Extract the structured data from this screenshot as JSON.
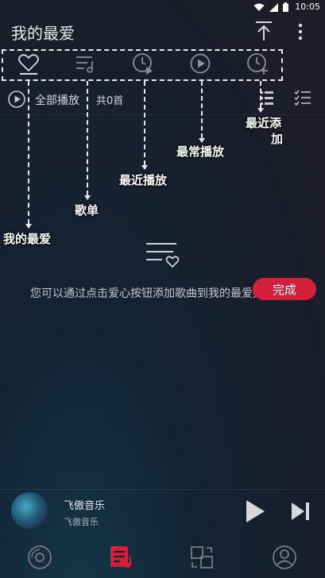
{
  "status_bar": {
    "time": "10:05",
    "icons": [
      "wifi-icon",
      "signal-icon",
      "battery-icon"
    ]
  },
  "header": {
    "title": "我的最爱",
    "icons": [
      "upload-top-icon",
      "more-vert-icon"
    ]
  },
  "tabs": [
    {
      "icon": "heart-icon"
    },
    {
      "icon": "playlist-icon"
    },
    {
      "icon": "recent-play-icon"
    },
    {
      "icon": "play-circle-icon"
    },
    {
      "icon": "recent-add-icon"
    }
  ],
  "play_all": {
    "label": "全部播放",
    "count": "共0首"
  },
  "annotations": {
    "favorite": "我的最爱",
    "playlist": "歌单",
    "recent_play": "最近播放",
    "frequent_play": "最常播放",
    "recent_add_line1": "最近添",
    "recent_add_line2": "加"
  },
  "empty_state": {
    "message": "您可以通过点击爱心按钮添加歌曲到我的最爱播放列表"
  },
  "done_button": {
    "label": "完成"
  },
  "player": {
    "title": "飞傲音乐",
    "artist": "飞傲音乐"
  },
  "bottom_nav": [
    {
      "icon": "music-disc-icon"
    },
    {
      "icon": "playlist-note-icon"
    },
    {
      "icon": "sync-icon"
    },
    {
      "icon": "user-icon"
    }
  ],
  "colors": {
    "accent": "#d21f3c",
    "annotation": "#ffffff",
    "dashed_line": "#e8e8e8"
  }
}
